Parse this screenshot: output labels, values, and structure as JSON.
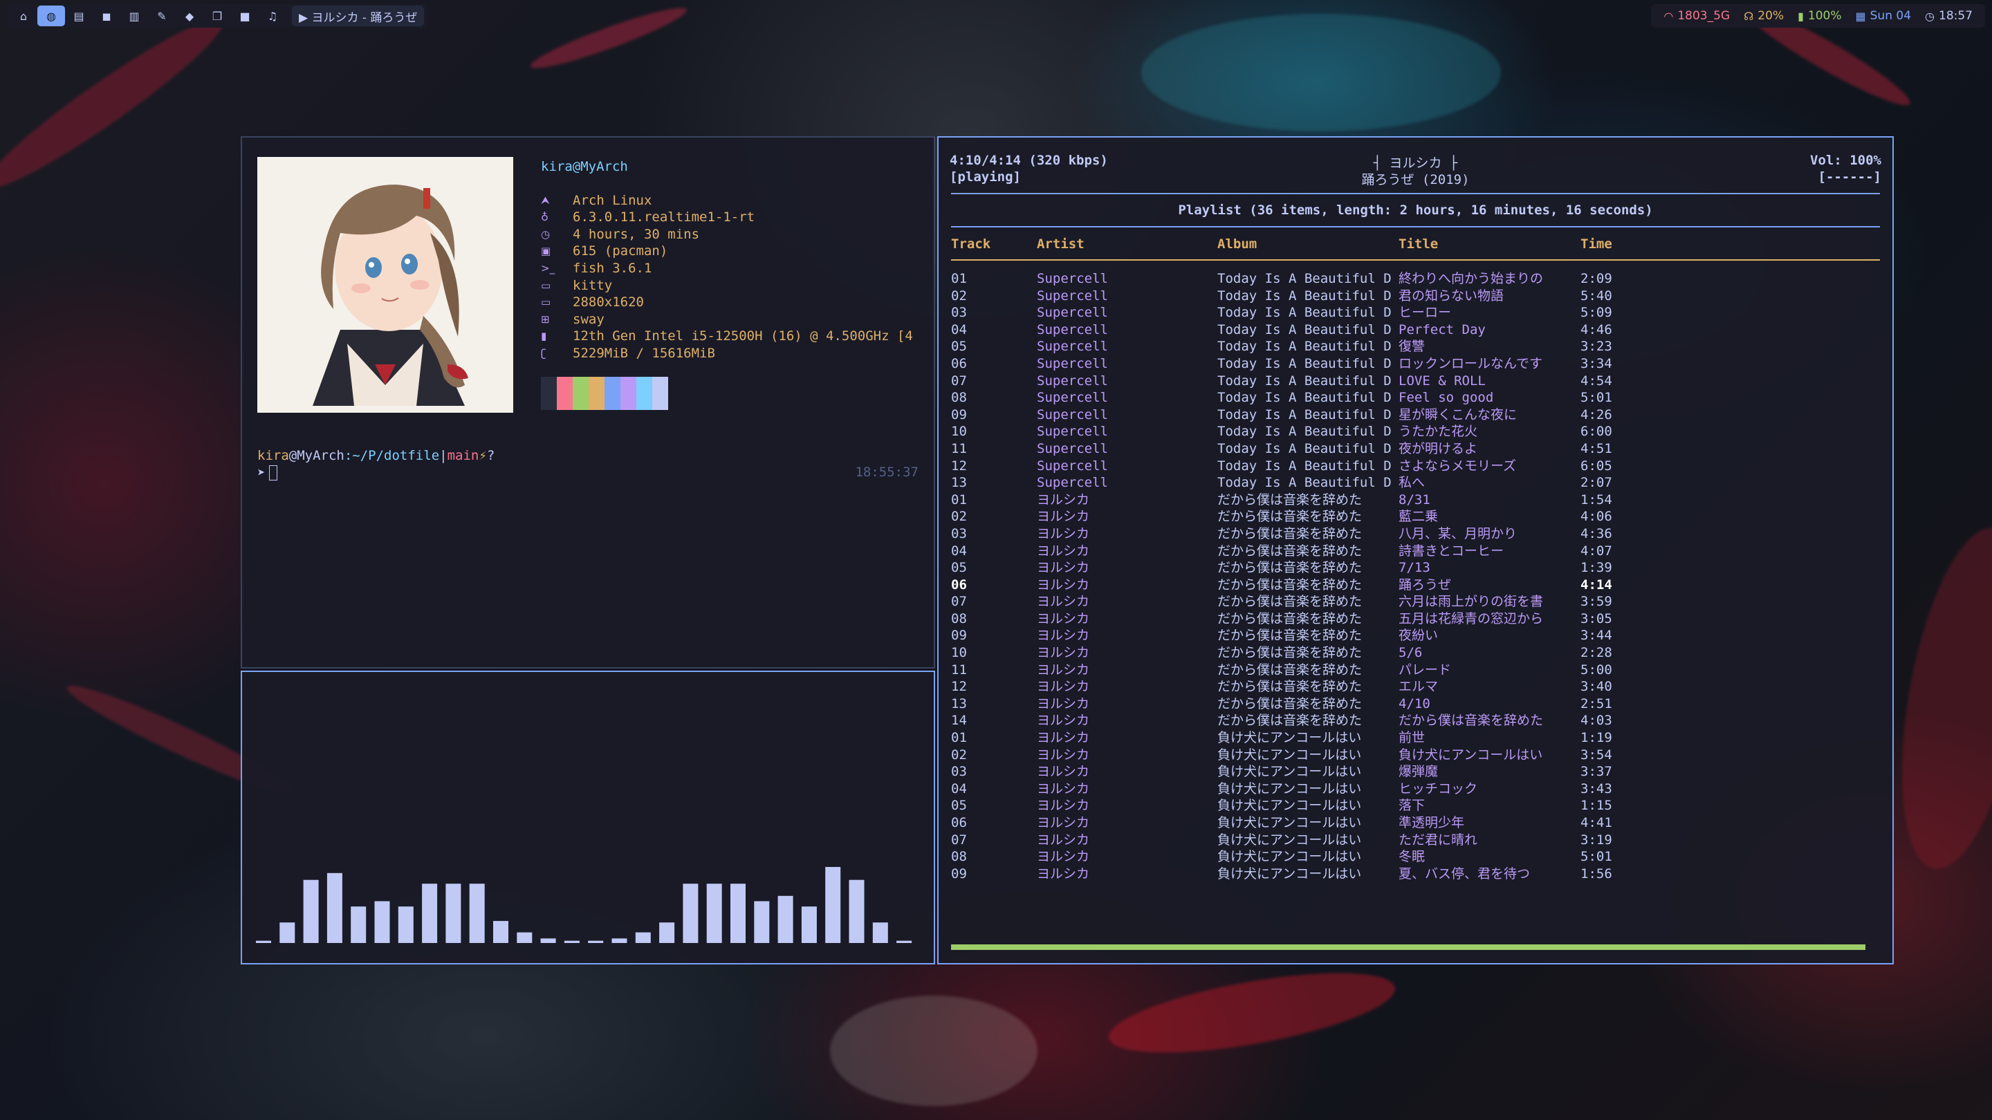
{
  "topbar": {
    "workspaces": [
      {
        "icon": "home-icon",
        "glyph": "⌂",
        "active": false
      },
      {
        "icon": "globe-icon",
        "glyph": "◍",
        "active": true
      },
      {
        "icon": "file-icon",
        "glyph": "▤",
        "active": false
      },
      {
        "icon": "chat-icon",
        "glyph": "◼",
        "active": false
      },
      {
        "icon": "book-icon",
        "glyph": "▥",
        "active": false
      },
      {
        "icon": "edit-icon",
        "glyph": "✎",
        "active": false
      },
      {
        "icon": "git-icon",
        "glyph": "◆",
        "active": false
      },
      {
        "icon": "window-icon",
        "glyph": "❐",
        "active": false
      },
      {
        "icon": "video-icon",
        "glyph": "■",
        "active": false
      },
      {
        "icon": "music-icon",
        "glyph": "♫",
        "active": false
      }
    ],
    "now_playing": "▶ ヨルシカ - 踊ろうぜ",
    "status": {
      "wifi": "1803_5G",
      "volume": "20%",
      "battery": "100%",
      "date": "Sun 04",
      "time": "18:57",
      "wifi_color": "#f7768e",
      "volume_color": "#e0af68",
      "battery_color": "#9ece6a",
      "date_color": "#7aa2f7",
      "time_color": "#c0caf5"
    }
  },
  "terminal": {
    "user_host": "kira@MyArch",
    "info": [
      {
        "icon": "arch-icon",
        "glyph": "⮝",
        "value": "Arch Linux"
      },
      {
        "icon": "kernel-icon",
        "glyph": "♁",
        "value": "6.3.0.11.realtime1-1-rt"
      },
      {
        "icon": "uptime-icon",
        "glyph": "◷",
        "value": "4 hours, 30 mins"
      },
      {
        "icon": "package-icon",
        "glyph": "▣",
        "value": "615 (pacman)"
      },
      {
        "icon": "shell-icon",
        "glyph": ">_",
        "value": "fish 3.6.1"
      },
      {
        "icon": "terminal-icon",
        "glyph": "▭",
        "value": "kitty"
      },
      {
        "icon": "display-icon",
        "glyph": "▭",
        "value": "2880x1620"
      },
      {
        "icon": "wm-icon",
        "glyph": "⊞",
        "value": "sway"
      },
      {
        "icon": "cpu-icon",
        "glyph": "▮",
        "value": "12th Gen Intel i5-12500H (16) @ 4.500GHz [4"
      },
      {
        "icon": "memory-icon",
        "glyph": "ʗ",
        "value": "5229MiB / 15616MiB"
      }
    ],
    "palette": [
      "#2a2d3e",
      "#f7768e",
      "#9ece6a",
      "#e0af68",
      "#7aa2f7",
      "#bb9af7",
      "#7dcfff",
      "#c0caf5"
    ],
    "prompt": {
      "user": "kira",
      "at": "@",
      "host": "MyArch",
      "path": ":~/P/dotfile",
      "sep": "|",
      "branch": "main",
      "flag": "⚡",
      "q": "?",
      "symbol": "➤",
      "right_time": "18:55:37"
    }
  },
  "cava": {
    "levels": [
      0.03,
      0.27,
      0.83,
      0.92,
      0.48,
      0.55,
      0.48,
      0.78,
      0.78,
      0.78,
      0.29,
      0.14,
      0.06,
      0.03,
      0.03,
      0.06,
      0.14,
      0.27,
      0.78,
      0.78,
      0.78,
      0.55,
      0.62,
      0.48,
      1.0,
      0.83,
      0.27,
      0.03
    ]
  },
  "ncmpcpp": {
    "time_info": "4:10/4:14 (320 kbps)",
    "state": "[playing]",
    "artist_line": "┤ ヨルシカ ├",
    "title_line": "踊ろうぜ (2019)",
    "volume": "Vol: 100%",
    "flags": "[------]",
    "playlist_title": "Playlist (36 items, length: 2 hours, 16 minutes, 16 seconds)",
    "columns": {
      "track": "Track",
      "artist": "Artist",
      "album": "Album",
      "title": "Title",
      "time": "Time"
    },
    "progress": 0.984,
    "tracks": [
      {
        "track": "01",
        "artist": "Supercell",
        "album": "Today Is A Beautiful D",
        "title": "終わりへ向かう始まりの",
        "time": "2:09"
      },
      {
        "track": "02",
        "artist": "Supercell",
        "album": "Today Is A Beautiful D",
        "title": "君の知らない物語",
        "time": "5:40"
      },
      {
        "track": "03",
        "artist": "Supercell",
        "album": "Today Is A Beautiful D",
        "title": "ヒーロー",
        "time": "5:09"
      },
      {
        "track": "04",
        "artist": "Supercell",
        "album": "Today Is A Beautiful D",
        "title": "Perfect Day",
        "time": "4:46"
      },
      {
        "track": "05",
        "artist": "Supercell",
        "album": "Today Is A Beautiful D",
        "title": "復讐",
        "time": "3:23"
      },
      {
        "track": "06",
        "artist": "Supercell",
        "album": "Today Is A Beautiful D",
        "title": "ロックンロールなんです",
        "time": "3:34"
      },
      {
        "track": "07",
        "artist": "Supercell",
        "album": "Today Is A Beautiful D",
        "title": "LOVE & ROLL",
        "time": "4:54"
      },
      {
        "track": "08",
        "artist": "Supercell",
        "album": "Today Is A Beautiful D",
        "title": "Feel so good",
        "time": "5:01"
      },
      {
        "track": "09",
        "artist": "Supercell",
        "album": "Today Is A Beautiful D",
        "title": "星が瞬くこんな夜に",
        "time": "4:26"
      },
      {
        "track": "10",
        "artist": "Supercell",
        "album": "Today Is A Beautiful D",
        "title": "うたかた花火",
        "time": "6:00"
      },
      {
        "track": "11",
        "artist": "Supercell",
        "album": "Today Is A Beautiful D",
        "title": "夜が明けるよ",
        "time": "4:51"
      },
      {
        "track": "12",
        "artist": "Supercell",
        "album": "Today Is A Beautiful D",
        "title": "さよならメモリーズ",
        "time": "6:05"
      },
      {
        "track": "13",
        "artist": "Supercell",
        "album": "Today Is A Beautiful D",
        "title": "私へ",
        "time": "2:07"
      },
      {
        "track": "01",
        "artist": "ヨルシカ",
        "album": "だから僕は音楽を辞めた",
        "title": "8/31",
        "time": "1:54"
      },
      {
        "track": "02",
        "artist": "ヨルシカ",
        "album": "だから僕は音楽を辞めた",
        "title": "藍二乗",
        "time": "4:06"
      },
      {
        "track": "03",
        "artist": "ヨルシカ",
        "album": "だから僕は音楽を辞めた",
        "title": "八月、某、月明かり",
        "time": "4:36"
      },
      {
        "track": "04",
        "artist": "ヨルシカ",
        "album": "だから僕は音楽を辞めた",
        "title": "詩書きとコーヒー",
        "time": "4:07"
      },
      {
        "track": "05",
        "artist": "ヨルシカ",
        "album": "だから僕は音楽を辞めた",
        "title": "7/13",
        "time": "1:39"
      },
      {
        "track": "06",
        "artist": "ヨルシカ",
        "album": "だから僕は音楽を辞めた",
        "title": "踊ろうぜ",
        "time": "4:14",
        "current": true
      },
      {
        "track": "07",
        "artist": "ヨルシカ",
        "album": "だから僕は音楽を辞めた",
        "title": "六月は雨上がりの街を書",
        "time": "3:59"
      },
      {
        "track": "08",
        "artist": "ヨルシカ",
        "album": "だから僕は音楽を辞めた",
        "title": "五月は花緑青の窓辺から",
        "time": "3:05"
      },
      {
        "track": "09",
        "artist": "ヨルシカ",
        "album": "だから僕は音楽を辞めた",
        "title": "夜紛い",
        "time": "3:44"
      },
      {
        "track": "10",
        "artist": "ヨルシカ",
        "album": "だから僕は音楽を辞めた",
        "title": "5/6",
        "time": "2:28"
      },
      {
        "track": "11",
        "artist": "ヨルシカ",
        "album": "だから僕は音楽を辞めた",
        "title": "パレード",
        "time": "5:00"
      },
      {
        "track": "12",
        "artist": "ヨルシカ",
        "album": "だから僕は音楽を辞めた",
        "title": "エルマ",
        "time": "3:40"
      },
      {
        "track": "13",
        "artist": "ヨルシカ",
        "album": "だから僕は音楽を辞めた",
        "title": "4/10",
        "time": "2:51"
      },
      {
        "track": "14",
        "artist": "ヨルシカ",
        "album": "だから僕は音楽を辞めた",
        "title": "だから僕は音楽を辞めた",
        "time": "4:03"
      },
      {
        "track": "01",
        "artist": "ヨルシカ",
        "album": "負け犬にアンコールはい",
        "title": "前世",
        "time": "1:19"
      },
      {
        "track": "02",
        "artist": "ヨルシカ",
        "album": "負け犬にアンコールはい",
        "title": "負け犬にアンコールはい",
        "time": "3:54"
      },
      {
        "track": "03",
        "artist": "ヨルシカ",
        "album": "負け犬にアンコールはい",
        "title": "爆弾魔",
        "time": "3:37"
      },
      {
        "track": "04",
        "artist": "ヨルシカ",
        "album": "負け犬にアンコールはい",
        "title": "ヒッチコック",
        "time": "3:43"
      },
      {
        "track": "05",
        "artist": "ヨルシカ",
        "album": "負け犬にアンコールはい",
        "title": "落下",
        "time": "1:15"
      },
      {
        "track": "06",
        "artist": "ヨルシカ",
        "album": "負け犬にアンコールはい",
        "title": "準透明少年",
        "time": "4:41"
      },
      {
        "track": "07",
        "artist": "ヨルシカ",
        "album": "負け犬にアンコールはい",
        "title": "ただ君に晴れ",
        "time": "3:19"
      },
      {
        "track": "08",
        "artist": "ヨルシカ",
        "album": "負け犬にアンコールはい",
        "title": "冬眠",
        "time": "5:01"
      },
      {
        "track": "09",
        "artist": "ヨルシカ",
        "album": "負け犬にアンコールはい",
        "title": "夏、バス停、君を待つ",
        "time": "1:56"
      }
    ]
  }
}
